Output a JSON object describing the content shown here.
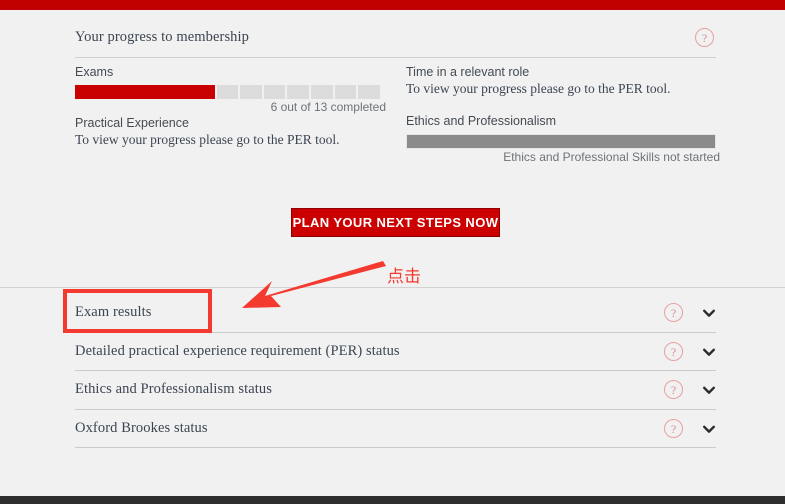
{
  "theme": {
    "brand_red": "#c10000",
    "button_red": "#cc0000",
    "progress_fill_red": "#c90000",
    "progress_track_gray": "#dcdcdc",
    "ethics_bar_gray": "#8b8b8b",
    "page_background": "#f1f1f1",
    "annotation_red": "#f4392f"
  },
  "panel": {
    "heading": "Your progress to membership",
    "help_icon": "question-mark-icon",
    "help_label": "?"
  },
  "progress": {
    "left_column": [
      {
        "label": "Exams",
        "type": "segmented-bar",
        "completed": 6,
        "total": 13,
        "caption": "6 out of 13 completed"
      },
      {
        "label": "Practical Experience",
        "type": "text",
        "subtext": "To view your progress please go to the PER tool."
      }
    ],
    "right_column": [
      {
        "label": "Time in a relevant role",
        "type": "text",
        "subtext": "To view your progress please go to the PER tool."
      },
      {
        "label": "Ethics and Professionalism",
        "type": "solid-bar",
        "caption": "Ethics and Professional Skills not started"
      }
    ]
  },
  "cta": {
    "label": "PLAN YOUR NEXT STEPS NOW"
  },
  "accordion": {
    "rows": [
      {
        "label": "Exam results",
        "help_label": "?",
        "chevron": "chevron-down-icon"
      },
      {
        "label": "Detailed practical experience requirement (PER) status",
        "help_label": "?",
        "chevron": "chevron-down-icon"
      },
      {
        "label": "Ethics and Professionalism status",
        "help_label": "?",
        "chevron": "chevron-down-icon"
      },
      {
        "label": "Oxford Brookes status",
        "help_label": "?",
        "chevron": "chevron-down-icon"
      }
    ]
  },
  "annotation": {
    "text": "点击",
    "arrow": "arrow-pointing-down-left",
    "highlight_target": "Exam results"
  }
}
